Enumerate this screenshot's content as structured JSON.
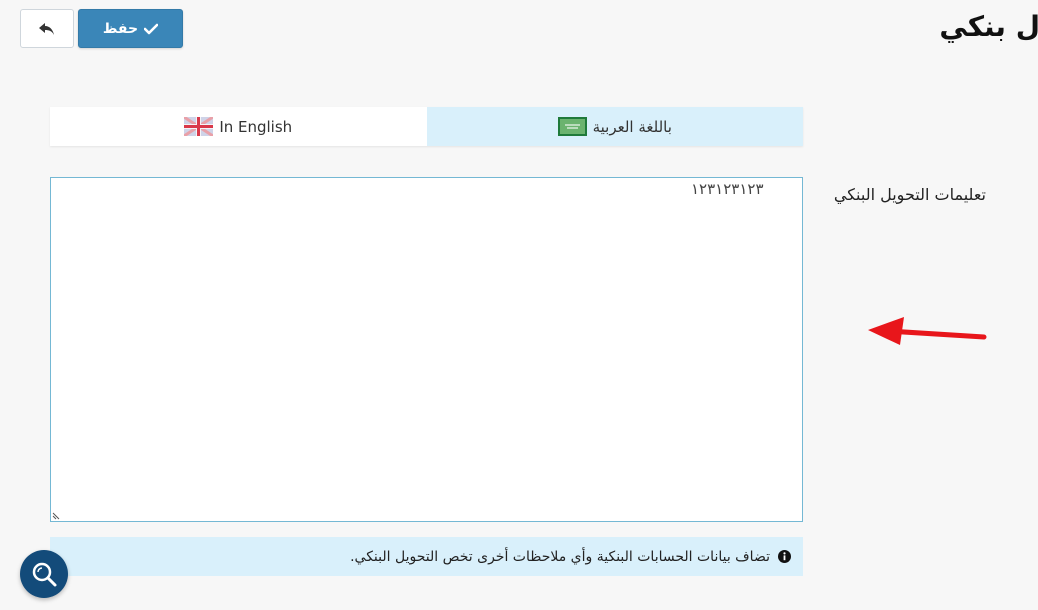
{
  "header": {
    "title": "ل بنكي",
    "save_label": "حفظ",
    "save_icon": "check-icon",
    "back_icon": "reply-icon"
  },
  "language_tabs": [
    {
      "label": "In English",
      "flag": "uk-flag-icon",
      "active": false
    },
    {
      "label": "باللغة العربية",
      "flag": "saudi-flag-icon",
      "active": true
    }
  ],
  "form": {
    "field_label": "تعليمات التحويل البنكي",
    "field_value": "١٢٣١٢٣١٢٣"
  },
  "help": {
    "icon": "info-icon",
    "text": "تضاف بيانات الحسابات البنكية وأي ملاحظات أخرى تخص التحويل البنكي."
  },
  "colors": {
    "primary": "#3a86b8",
    "active_tab": "#d9f0fb",
    "annotation_arrow": "#e8161b",
    "fab": "#134b7a"
  }
}
